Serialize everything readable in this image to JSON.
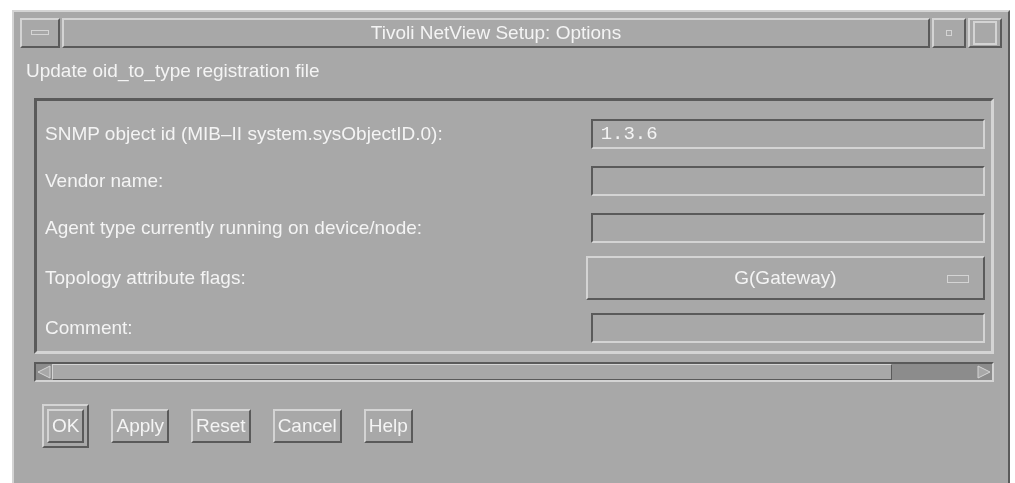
{
  "window": {
    "title": "Tivoli NetView Setup: Options"
  },
  "heading": "Update oid_to_type registration file",
  "fields": [
    {
      "kind": "text",
      "label": "SNMP object id (MIB–II system.sysObjectID.0):",
      "value": "1.3.6"
    },
    {
      "kind": "text",
      "label": "Vendor name:"
    },
    {
      "kind": "text",
      "label": "Agent type currently running on device/node:"
    },
    {
      "kind": "option",
      "label": "Topology attribute flags:",
      "value": "G(Gateway)"
    },
    {
      "kind": "text",
      "label": "Comment:"
    }
  ],
  "buttons": [
    {
      "label": "OK",
      "default": true
    },
    {
      "label": "Apply",
      "default": false
    },
    {
      "label": "Reset",
      "default": false
    },
    {
      "label": "Cancel",
      "default": false
    },
    {
      "label": "Help",
      "default": false
    }
  ]
}
